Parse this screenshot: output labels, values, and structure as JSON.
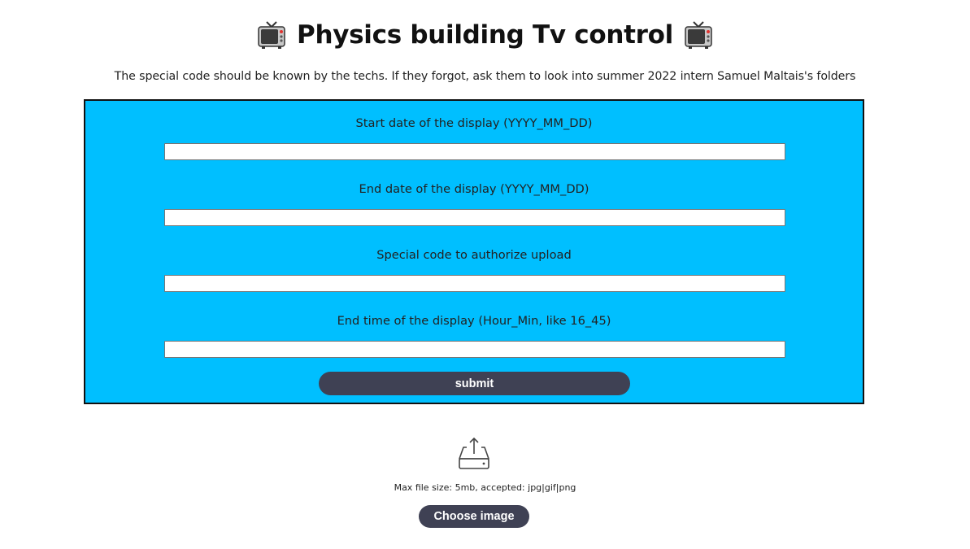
{
  "header": {
    "title": "Physics building Tv control",
    "left_icon": "television-icon",
    "right_icon": "television-icon",
    "subtitle": "The special code should be known by the techs. If they forgot, ask them to look into summer 2022 intern Samuel Maltais's folders"
  },
  "form": {
    "background_color": "#00bfff",
    "fields": [
      {
        "label": "Start date of the display (YYYY_MM_DD)",
        "value": ""
      },
      {
        "label": "End date of the display (YYYY_MM_DD)",
        "value": ""
      },
      {
        "label": "Special code to authorize upload",
        "value": ""
      },
      {
        "label": "End time of the display (Hour_Min, like 16_45)",
        "value": ""
      }
    ],
    "submit_label": "submit",
    "button_color": "#3f4154"
  },
  "upload": {
    "icon": "inbox-upload-icon",
    "note": "Max file size: 5mb, accepted: jpg|gif|png",
    "choose_label": "Choose image"
  }
}
